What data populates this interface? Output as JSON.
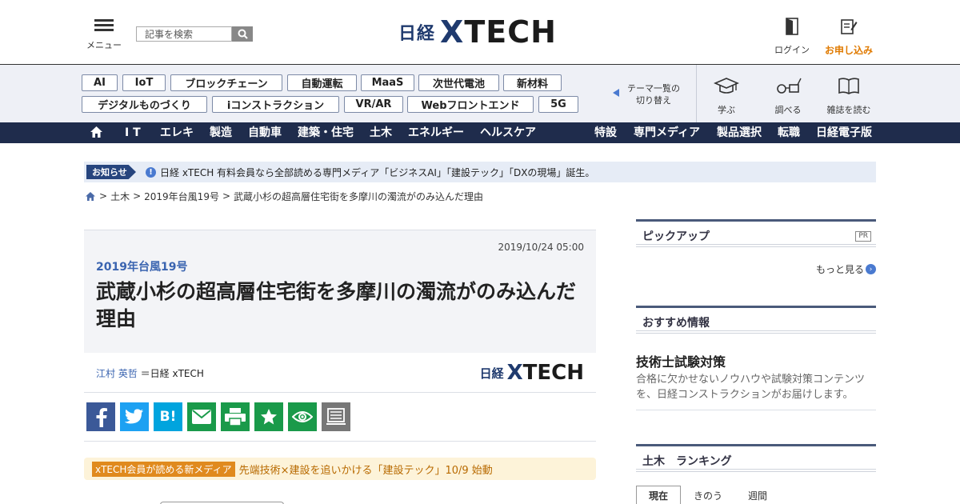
{
  "header": {
    "menu_label": "メニュー",
    "search_placeholder": "記事を検索",
    "logo_nikkei": "日経",
    "logo_xtech_x": "X",
    "logo_xtech_rest": "TECH",
    "login_label": "ログイン",
    "signup_label": "お申し込み"
  },
  "themes": {
    "tags": [
      "AI",
      "IoT",
      "ブロックチェーン",
      "自動運転",
      "MaaS",
      "次世代電池",
      "新材料",
      "デジタルものづくり",
      "iコンストラクション",
      "VR/AR",
      "Webフロントエンド",
      "5G"
    ],
    "switch_line1": "テーマ一覧の",
    "switch_line2": "切り替え",
    "quick_links": [
      "学ぶ",
      "調べる",
      "雑誌を読む"
    ]
  },
  "nav": {
    "left": [
      "I T",
      "エレキ",
      "製造",
      "自動車",
      "建築・住宅",
      "土木",
      "エネルギー",
      "ヘルスケア"
    ],
    "right": [
      "特設",
      "専門メディア",
      "製品選択",
      "転職",
      "日経電子版"
    ]
  },
  "notice": {
    "badge": "お知らせ",
    "text": "日経 xTECH 有料会員なら全部読める専門メディア「ビジネスAI」「建設テック」「DXの現場」誕生。"
  },
  "breadcrumb": {
    "items": [
      "土木",
      "2019年台風19号",
      "武蔵小杉の超高層住宅街を多摩川の濁流がのみ込んだ理由"
    ]
  },
  "article": {
    "date": "2019/10/24 05:00",
    "kicker": "2019年台風19号",
    "title": "武蔵小杉の超高層住宅街を多摩川の濁流がのみ込んだ理由",
    "author": "江村 英哲",
    "publisher": "＝日経 xTECH"
  },
  "share": {
    "buttons": [
      {
        "name": "facebook",
        "color": "#3b5998"
      },
      {
        "name": "twitter",
        "color": "#1da1f2"
      },
      {
        "name": "hatena",
        "color": "#00a4de"
      },
      {
        "name": "mail",
        "color": "#1a9a4a"
      },
      {
        "name": "print",
        "color": "#1a9a4a"
      },
      {
        "name": "clip",
        "color": "#1a9a4a"
      },
      {
        "name": "watch",
        "color": "#1a9a4a"
      },
      {
        "name": "memo",
        "color": "#777777"
      }
    ]
  },
  "promo": {
    "badge": "xTECH会員が読める新メディア",
    "text": "先端技術×建設を追いかける「建設テック」10/9 始動"
  },
  "sidebar": {
    "pickup_title": "ピックアップ",
    "pickup_pr": "PR",
    "more_label": "もっと見る",
    "recommend_title": "おすすめ情報",
    "rec_item_title": "技術士試験対策",
    "rec_item_desc": "合格に欠かせないノウハウや試験対策コンテンツを、日経コンストラクションがお届けします。",
    "ranking_title": "土木　ランキング",
    "ranking_tabs": [
      "現在",
      "きのう",
      "週間"
    ]
  }
}
